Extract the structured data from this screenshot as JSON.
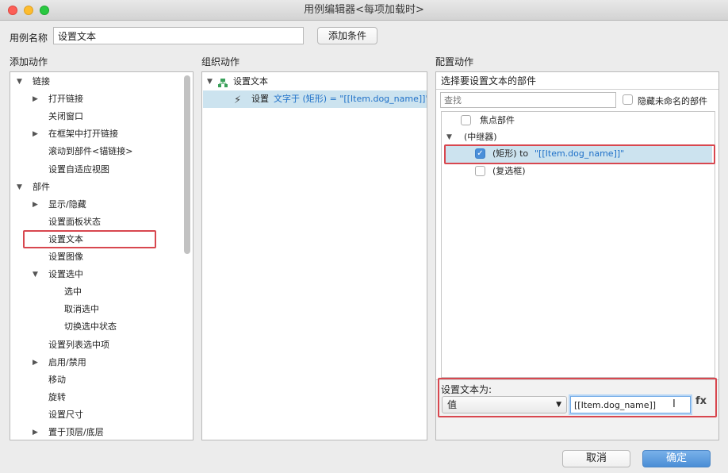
{
  "window": {
    "title": "用例编辑器<每项加载时>"
  },
  "case_name": {
    "label": "用例名称",
    "value": "设置文本",
    "add_condition": "添加条件"
  },
  "columns": {
    "add": "添加动作",
    "organize": "组织动作",
    "configure": "配置动作"
  },
  "add_actions": [
    {
      "label": "链接",
      "indent": 0,
      "arrow": "▼"
    },
    {
      "label": "打开链接",
      "indent": 1,
      "arrow": "▶"
    },
    {
      "label": "关闭窗口",
      "indent": 1,
      "arrow": ""
    },
    {
      "label": "在框架中打开链接",
      "indent": 1,
      "arrow": "▶"
    },
    {
      "label": "滚动到部件<锚链接>",
      "indent": 1,
      "arrow": ""
    },
    {
      "label": "设置自适应视图",
      "indent": 1,
      "arrow": ""
    },
    {
      "label": "部件",
      "indent": 0,
      "arrow": "▼"
    },
    {
      "label": "显示/隐藏",
      "indent": 1,
      "arrow": "▶"
    },
    {
      "label": "设置面板状态",
      "indent": 1,
      "arrow": ""
    },
    {
      "label": "设置文本",
      "indent": 1,
      "arrow": ""
    },
    {
      "label": "设置图像",
      "indent": 1,
      "arrow": ""
    },
    {
      "label": "设置选中",
      "indent": 1,
      "arrow": "▼"
    },
    {
      "label": "选中",
      "indent": 2,
      "arrow": ""
    },
    {
      "label": "取消选中",
      "indent": 2,
      "arrow": ""
    },
    {
      "label": "切换选中状态",
      "indent": 2,
      "arrow": ""
    },
    {
      "label": "设置列表选中项",
      "indent": 1,
      "arrow": ""
    },
    {
      "label": "启用/禁用",
      "indent": 1,
      "arrow": "▶"
    },
    {
      "label": "移动",
      "indent": 1,
      "arrow": ""
    },
    {
      "label": "旋转",
      "indent": 1,
      "arrow": ""
    },
    {
      "label": "设置尺寸",
      "indent": 1,
      "arrow": ""
    },
    {
      "label": "置于顶层/底层",
      "indent": 1,
      "arrow": "▶"
    }
  ],
  "organize": {
    "case_label": "设置文本",
    "action_prefix": "设置",
    "action_detail": "文字于 (矩形) = \"[[Item.dog_name]]\""
  },
  "configure": {
    "header": "选择要设置文本的部件",
    "search_placeholder": "查找",
    "hide_unnamed": "隐藏未命名的部件",
    "widgets": [
      {
        "label": "焦点部件",
        "checked": false
      },
      {
        "label": "(中继器)",
        "group": true
      },
      {
        "label": "(矩形) to",
        "value": "\"[[Item.dog_name]]\"",
        "checked": true
      },
      {
        "label": "(复选框)",
        "checked": false
      }
    ],
    "set_text_label": "设置文本为:",
    "type_value": "值",
    "text_value": "[[Item.dog_name]]",
    "fx": "fx"
  },
  "footer": {
    "cancel": "取消",
    "ok": "确定"
  },
  "colors": {
    "highlight": "#cce3ef",
    "annotation": "#d8474f",
    "ok": "#4b8ed6",
    "link": "#1e70c8"
  }
}
